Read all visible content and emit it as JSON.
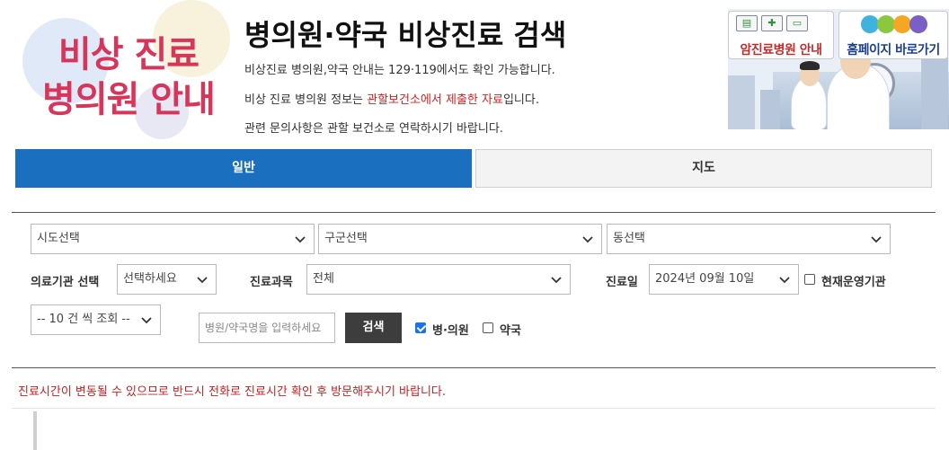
{
  "logo": {
    "line1": "비상 진료",
    "line2": "병의원 안내"
  },
  "header": {
    "title": "병의원·약국 비상진료 검색",
    "info_line_1": "비상진료 병의원,약국 안내는 129·119에서도 확인 가능합니다.",
    "info_line_2_pre": "비상 진료 병의원 정보는 ",
    "info_line_2_highlight": "관할보건소에서 제출한 자료",
    "info_line_2_post": "입니다.",
    "info_line_3": "관련 문의사항은 관할 보건소로 연락하시기 바랍니다."
  },
  "banner": {
    "cancer_hospital_label": "암진료병원 안내",
    "homepage_label": "홈페이지 바로가기"
  },
  "tabs": [
    {
      "label": "일반",
      "active": true
    },
    {
      "label": "지도",
      "active": false
    }
  ],
  "search": {
    "sido_select": "시도선택",
    "gugun_select": "구군선택",
    "dong_select": "동선택",
    "institution_type_label": "의료기관 선택",
    "institution_type_value": "선택하세요",
    "department_label": "진료과목",
    "department_value": "전체",
    "date_label": "진료일",
    "date_value": "2024년 09월 10일",
    "currently_open_label": "현재운영기관",
    "currently_open_checked": false,
    "page_size_value": "-- 10 건 씩 조회 --",
    "name_placeholder": "병원/약국명을 입력하세요",
    "search_button": "검색",
    "hospital_check_label": "병·의원",
    "hospital_checked": true,
    "pharmacy_check_label": "약국",
    "pharmacy_checked": false
  },
  "notice": "진료시간이 변동될 수 있으므로 반드시 전화로 진료시간 확인 후 방문해주시기 바랍니다.",
  "colors": {
    "accent": "#1a6fbe",
    "logo_pink": "#d7355a",
    "warning_red": "#c81e1e",
    "search_button": "#3d3d3d"
  }
}
